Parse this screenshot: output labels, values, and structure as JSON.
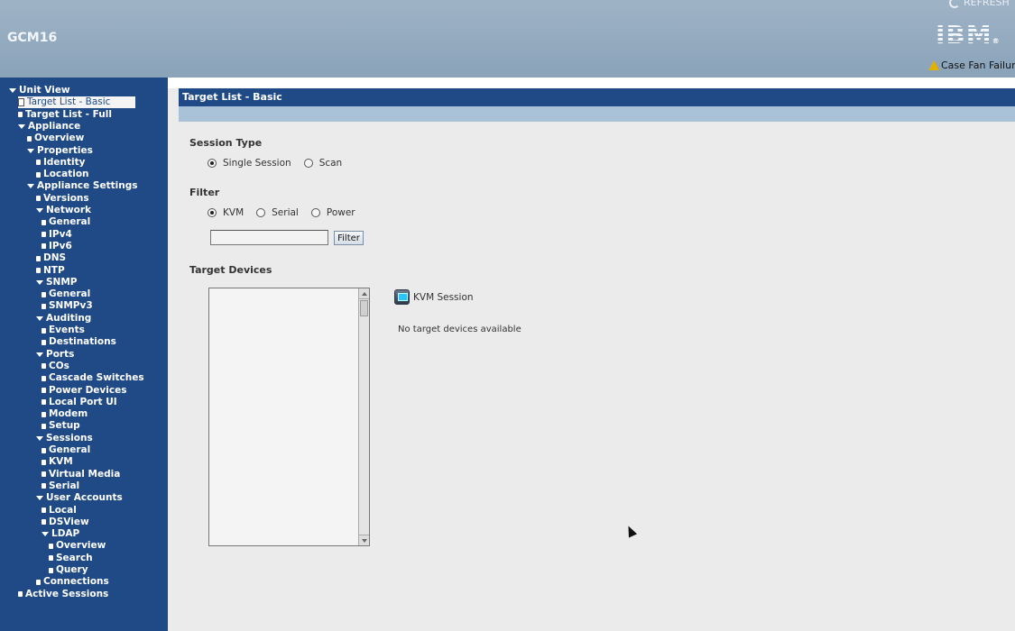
{
  "header": {
    "unit_name": "GCM16",
    "refresh_label": "REFRESH",
    "brand": "IBM",
    "alert_text": "Case Fan Failure"
  },
  "sidebar": {
    "items": [
      {
        "label": "Unit View",
        "level": 0,
        "expander": true
      },
      {
        "label": "Target List - Basic",
        "level": 1,
        "selected": true
      },
      {
        "label": "Target List - Full",
        "level": 1
      },
      {
        "label": "Appliance",
        "level": 1,
        "expander": true
      },
      {
        "label": "Overview",
        "level": 2
      },
      {
        "label": "Properties",
        "level": 2,
        "expander": true
      },
      {
        "label": "Identity",
        "level": 3
      },
      {
        "label": "Location",
        "level": 3
      },
      {
        "label": "Appliance Settings",
        "level": 2,
        "expander": true
      },
      {
        "label": "Versions",
        "level": 3
      },
      {
        "label": "Network",
        "level": 3,
        "expander": true
      },
      {
        "label": "General",
        "level": 4
      },
      {
        "label": "IPv4",
        "level": 4
      },
      {
        "label": "IPv6",
        "level": 4
      },
      {
        "label": "DNS",
        "level": 3
      },
      {
        "label": "NTP",
        "level": 3
      },
      {
        "label": "SNMP",
        "level": 3,
        "expander": true
      },
      {
        "label": "General",
        "level": 4
      },
      {
        "label": "SNMPv3",
        "level": 4
      },
      {
        "label": "Auditing",
        "level": 3,
        "expander": true
      },
      {
        "label": "Events",
        "level": 4
      },
      {
        "label": "Destinations",
        "level": 4
      },
      {
        "label": "Ports",
        "level": 3,
        "expander": true
      },
      {
        "label": "COs",
        "level": 4
      },
      {
        "label": "Cascade Switches",
        "level": 4
      },
      {
        "label": "Power Devices",
        "level": 4
      },
      {
        "label": "Local Port UI",
        "level": 4
      },
      {
        "label": "Modem",
        "level": 4
      },
      {
        "label": "Setup",
        "level": 4
      },
      {
        "label": "Sessions",
        "level": 3,
        "expander": true
      },
      {
        "label": "General",
        "level": 4
      },
      {
        "label": "KVM",
        "level": 4
      },
      {
        "label": "Virtual Media",
        "level": 4
      },
      {
        "label": "Serial",
        "level": 4
      },
      {
        "label": "User Accounts",
        "level": 3,
        "expander": true
      },
      {
        "label": "Local",
        "level": 4
      },
      {
        "label": "DSView",
        "level": 4
      },
      {
        "label": "LDAP",
        "level": 4,
        "expander": true
      },
      {
        "label": "Overview",
        "level": 5
      },
      {
        "label": "Search",
        "level": 5
      },
      {
        "label": "Query",
        "level": 5
      },
      {
        "label": "Connections",
        "level": 3
      },
      {
        "label": "Active Sessions",
        "level": 1
      }
    ]
  },
  "main": {
    "title": "Target List - Basic",
    "session_type": {
      "label": "Session Type",
      "options": [
        "Single Session",
        "Scan"
      ],
      "selected": "Single Session"
    },
    "filter": {
      "label": "Filter",
      "options": [
        "KVM",
        "Serial",
        "Power"
      ],
      "selected": "KVM",
      "input_value": "",
      "button_label": "Filter"
    },
    "target_devices": {
      "label": "Target Devices",
      "session_label": "KVM Session",
      "empty_message": "No target devices available"
    }
  }
}
